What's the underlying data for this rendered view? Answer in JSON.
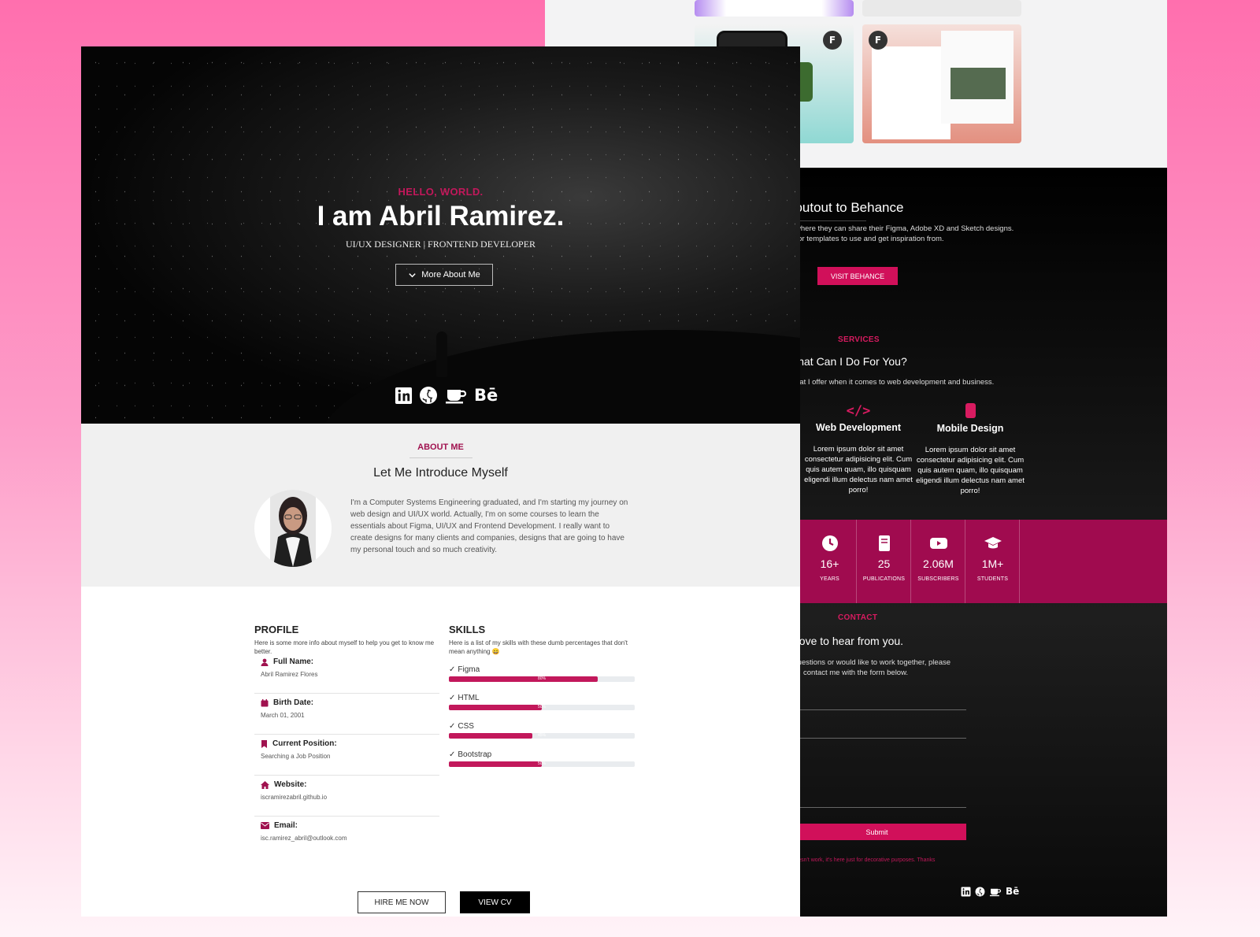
{
  "hero": {
    "greeting": "HELLO, WORLD.",
    "name": "I am Abril Ramirez.",
    "role": "UI/UX DESIGNER | FRONTEND DEVELOPER",
    "more_label": "More About Me",
    "social_icons": [
      "linkedin-icon",
      "github-icon",
      "coffee-icon",
      "behance-icon"
    ]
  },
  "about": {
    "label": "ABOUT ME",
    "title": "Let Me Introduce Myself",
    "text": "I'm a Computer Systems Engineering graduated, and I'm starting my journey on web design and UI/UX world. Actually, I'm on some courses to learn the essentials about Figma, UI/UX and Frontend Development. I really want to create designs for many clients and companies, designs that are going to have my personal touch and so much creativity."
  },
  "profile": {
    "heading": "PROFILE",
    "intro": "Here is some more info about myself to help you get to know me better.",
    "rows": [
      {
        "key": "Full Name:",
        "value": "Abril Ramirez Flores",
        "icon": "user-icon"
      },
      {
        "key": "Birth Date:",
        "value": "March 01, 2001",
        "icon": "calendar-icon"
      },
      {
        "key": "Current Position:",
        "value": "Searching a Job Position",
        "icon": "bookmark-icon"
      },
      {
        "key": "Website:",
        "value": "iscramirezabril.github.io",
        "icon": "home-icon"
      },
      {
        "key": "Email:",
        "value": "isc.ramirez_abril@outlook.com",
        "icon": "envelope-icon"
      }
    ]
  },
  "skills": {
    "heading": "SKILLS",
    "intro": "Here is a list of my skills with these dumb percentages that don't mean anything 😄",
    "items": [
      {
        "name": "Figma",
        "percent": 80,
        "label": "80%"
      },
      {
        "name": "HTML",
        "percent": 50,
        "label": "50%"
      },
      {
        "name": "CSS",
        "percent": 45,
        "label": "45%"
      },
      {
        "name": "Bootstrap",
        "percent": 50,
        "label": "50%"
      }
    ]
  },
  "buttons": {
    "hire": "HIRE ME NOW",
    "cv": "VIEW CV"
  },
  "behance": {
    "title": "houtout to Behance",
    "text1": "s, where they can share their Figma, Adobe XD and Sketch designs.",
    "text2": "ut for templates to use and get inspiration from.",
    "button": "VISIT BEHANCE"
  },
  "services": {
    "label": "SERVICES",
    "title": "What Can I Do For You?",
    "text": "s that I offer when it comes to web development and business.",
    "items": [
      {
        "title": "Web Development",
        "text": "Lorem ipsum dolor sit amet consectetur adipisicing elit. Cum quis autem quam, illo quisquam eligendi illum delectus nam amet porro!",
        "icon": "code-icon"
      },
      {
        "title": "Mobile Design",
        "text": "Lorem ipsum dolor sit amet consectetur adipisicing elit. Cum quis autem quam, illo quisquam eligendi illum delectus nam amet porro!",
        "icon": "mobile-icon"
      }
    ]
  },
  "stats": [
    {
      "value": "16+",
      "label": "YEARS",
      "icon": "clock-icon"
    },
    {
      "value": "25",
      "label": "PUBLICATIONS",
      "icon": "book-icon"
    },
    {
      "value": "2.06M",
      "label": "SUBSCRIBERS",
      "icon": "youtube-icon"
    },
    {
      "value": "1M+",
      "label": "STUDENTS",
      "icon": "graduation-cap-icon"
    }
  ],
  "contact": {
    "label": "CONTACT",
    "title": "d love to hear from you.",
    "text1": "y questions or would like to work together, please",
    "text2": "contact me with the form below.",
    "submit": "Submit",
    "note": "y doesn't work, it's here just for decorative purposes. Thanks"
  },
  "colors": {
    "accent": "#c2185b",
    "stats_bg": "#a00b4f",
    "dark": "#000000"
  }
}
